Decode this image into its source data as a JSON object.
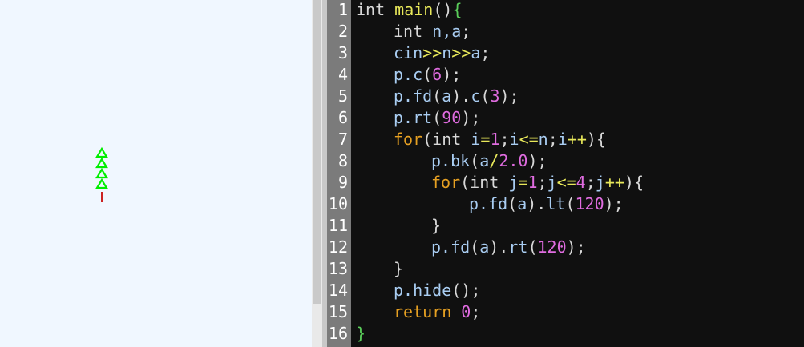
{
  "canvas": {
    "background": "#f0f7ff",
    "tree": {
      "branch_color": "#00ee00",
      "trunk_color": "#cc2222",
      "branches": 4
    }
  },
  "editor": {
    "background": "#101010",
    "gutter_color": "#7b7b7b",
    "lines": [
      {
        "num": "1",
        "indent": 0,
        "tokens": [
          {
            "t": "int ",
            "c": "pc"
          },
          {
            "t": "main",
            "c": "op"
          },
          {
            "t": "()",
            "c": "pc"
          },
          {
            "t": "{",
            "c": "br"
          }
        ]
      },
      {
        "num": "2",
        "indent": 1,
        "tokens": [
          {
            "t": "int ",
            "c": "pc"
          },
          {
            "t": "n,a",
            "c": "id"
          },
          {
            "t": ";",
            "c": "pc"
          }
        ]
      },
      {
        "num": "3",
        "indent": 1,
        "tokens": [
          {
            "t": "cin",
            "c": "id"
          },
          {
            "t": ">>",
            "c": "op"
          },
          {
            "t": "n",
            "c": "id"
          },
          {
            "t": ">>",
            "c": "op"
          },
          {
            "t": "a",
            "c": "id"
          },
          {
            "t": ";",
            "c": "pc"
          }
        ]
      },
      {
        "num": "4",
        "indent": 1,
        "tokens": [
          {
            "t": "p.c",
            "c": "id"
          },
          {
            "t": "(",
            "c": "pc"
          },
          {
            "t": "6",
            "c": "num"
          },
          {
            "t": ");",
            "c": "pc"
          }
        ]
      },
      {
        "num": "5",
        "indent": 1,
        "tokens": [
          {
            "t": "p.fd",
            "c": "id"
          },
          {
            "t": "(",
            "c": "pc"
          },
          {
            "t": "a",
            "c": "id"
          },
          {
            "t": ").",
            "c": "pc"
          },
          {
            "t": "c",
            "c": "id"
          },
          {
            "t": "(",
            "c": "pc"
          },
          {
            "t": "3",
            "c": "num"
          },
          {
            "t": ");",
            "c": "pc"
          }
        ]
      },
      {
        "num": "6",
        "indent": 1,
        "tokens": [
          {
            "t": "p.rt",
            "c": "id"
          },
          {
            "t": "(",
            "c": "pc"
          },
          {
            "t": "90",
            "c": "num"
          },
          {
            "t": ");",
            "c": "pc"
          }
        ]
      },
      {
        "num": "7",
        "indent": 1,
        "tokens": [
          {
            "t": "for",
            "c": "kw"
          },
          {
            "t": "(",
            "c": "pc"
          },
          {
            "t": "int ",
            "c": "pc"
          },
          {
            "t": "i",
            "c": "id"
          },
          {
            "t": "=",
            "c": "op"
          },
          {
            "t": "1",
            "c": "num"
          },
          {
            "t": ";",
            "c": "pc"
          },
          {
            "t": "i",
            "c": "id"
          },
          {
            "t": "<=",
            "c": "op"
          },
          {
            "t": "n",
            "c": "id"
          },
          {
            "t": ";",
            "c": "pc"
          },
          {
            "t": "i",
            "c": "id"
          },
          {
            "t": "++",
            "c": "op"
          },
          {
            "t": "){",
            "c": "pc"
          }
        ]
      },
      {
        "num": "8",
        "indent": 2,
        "tokens": [
          {
            "t": "p.bk",
            "c": "id"
          },
          {
            "t": "(",
            "c": "pc"
          },
          {
            "t": "a",
            "c": "id"
          },
          {
            "t": "/",
            "c": "op"
          },
          {
            "t": "2.0",
            "c": "num"
          },
          {
            "t": ");",
            "c": "pc"
          }
        ]
      },
      {
        "num": "9",
        "indent": 2,
        "tokens": [
          {
            "t": "for",
            "c": "kw"
          },
          {
            "t": "(",
            "c": "pc"
          },
          {
            "t": "int ",
            "c": "pc"
          },
          {
            "t": "j",
            "c": "id"
          },
          {
            "t": "=",
            "c": "op"
          },
          {
            "t": "1",
            "c": "num"
          },
          {
            "t": ";",
            "c": "pc"
          },
          {
            "t": "j",
            "c": "id"
          },
          {
            "t": "<=",
            "c": "op"
          },
          {
            "t": "4",
            "c": "num"
          },
          {
            "t": ";",
            "c": "pc"
          },
          {
            "t": "j",
            "c": "id"
          },
          {
            "t": "++",
            "c": "op"
          },
          {
            "t": "){",
            "c": "pc"
          }
        ]
      },
      {
        "num": "10",
        "indent": 3,
        "tokens": [
          {
            "t": "p.fd",
            "c": "id"
          },
          {
            "t": "(",
            "c": "pc"
          },
          {
            "t": "a",
            "c": "id"
          },
          {
            "t": ").",
            "c": "pc"
          },
          {
            "t": "lt",
            "c": "id"
          },
          {
            "t": "(",
            "c": "pc"
          },
          {
            "t": "120",
            "c": "num"
          },
          {
            "t": ");",
            "c": "pc"
          }
        ]
      },
      {
        "num": "11",
        "indent": 2,
        "tokens": [
          {
            "t": "}",
            "c": "pc"
          }
        ]
      },
      {
        "num": "12",
        "indent": 2,
        "tokens": [
          {
            "t": "p.fd",
            "c": "id"
          },
          {
            "t": "(",
            "c": "pc"
          },
          {
            "t": "a",
            "c": "id"
          },
          {
            "t": ").",
            "c": "pc"
          },
          {
            "t": "rt",
            "c": "id"
          },
          {
            "t": "(",
            "c": "pc"
          },
          {
            "t": "120",
            "c": "num"
          },
          {
            "t": ");",
            "c": "pc"
          }
        ]
      },
      {
        "num": "13",
        "indent": 1,
        "tokens": [
          {
            "t": "}",
            "c": "pc"
          }
        ]
      },
      {
        "num": "14",
        "indent": 1,
        "tokens": [
          {
            "t": "p.hide",
            "c": "id"
          },
          {
            "t": "();",
            "c": "pc"
          }
        ]
      },
      {
        "num": "15",
        "indent": 1,
        "tokens": [
          {
            "t": "return ",
            "c": "kw"
          },
          {
            "t": "0",
            "c": "num"
          },
          {
            "t": ";",
            "c": "pc"
          }
        ]
      },
      {
        "num": "16",
        "indent": 0,
        "tokens": [
          {
            "t": "}",
            "c": "br"
          }
        ]
      }
    ]
  }
}
